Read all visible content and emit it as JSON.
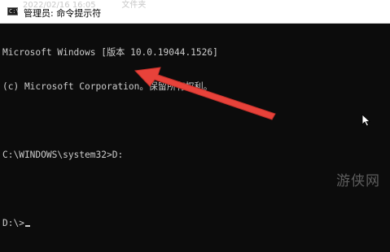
{
  "window": {
    "title": "管理员: 命令提示符",
    "icon": "console-icon",
    "bleed_text": "2022/02/16 16:05          文件夹"
  },
  "console": {
    "lines": [
      "Microsoft Windows [版本 10.0.19044.1526]",
      "(c) Microsoft Corporation。保留所有权利。",
      "",
      "C:\\WINDOWS\\system32>D:",
      "",
      "D:\\>"
    ]
  },
  "annotation": {
    "arrow_color": "#e8423a"
  },
  "watermark": {
    "text": "游侠网"
  },
  "colors": {
    "console_bg": "#0c0c0c",
    "console_text": "#cccccc",
    "titlebar_bg": "#ffffff"
  }
}
